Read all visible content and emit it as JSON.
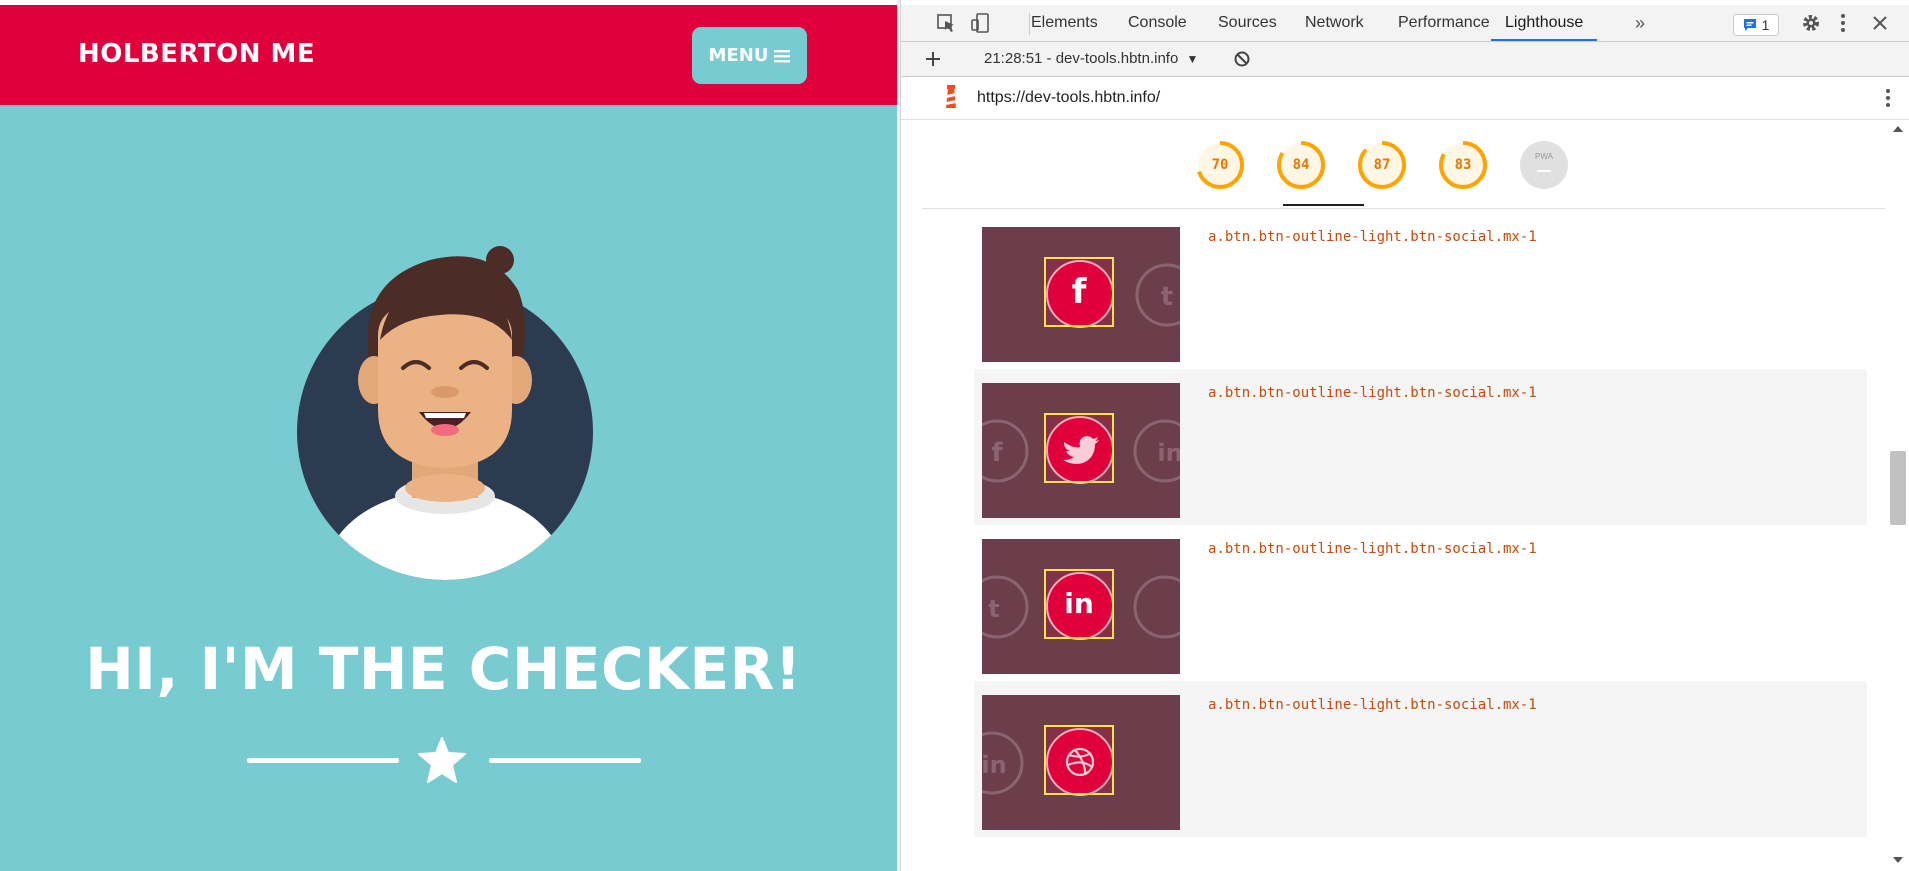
{
  "site": {
    "brand": "HOLBERTON ME",
    "menu_label": "MENU",
    "headline": "HI, I'M THE CHECKER!"
  },
  "devtools": {
    "tabs": [
      "Elements",
      "Console",
      "Sources",
      "Network",
      "Performance",
      "Lighthouse"
    ],
    "active_tab": "Lighthouse",
    "issues_count": "1",
    "report_label": "21:28:51 - dev-tools.hbtn.info",
    "url": "https://dev-tools.hbtn.info/",
    "scores": [
      {
        "value": "70",
        "fraction": 0.7
      },
      {
        "value": "84",
        "fraction": 0.84
      },
      {
        "value": "87",
        "fraction": 0.87
      },
      {
        "value": "83",
        "fraction": 0.83
      }
    ],
    "pwa_label": "PWA",
    "items": [
      {
        "selector": "a.btn.btn-outline-light.btn-social.mx-1",
        "icon": "facebook-icon",
        "glyph": "f"
      },
      {
        "selector": "a.btn.btn-outline-light.btn-social.mx-1",
        "icon": "twitter-icon",
        "glyph": ""
      },
      {
        "selector": "a.btn.btn-outline-light.btn-social.mx-1",
        "icon": "linkedin-icon",
        "glyph": "in"
      },
      {
        "selector": "a.btn.btn-outline-light.btn-social.mx-1",
        "icon": "dribbble-icon",
        "glyph": ""
      }
    ]
  },
  "colors": {
    "navbar": "#e0003b",
    "page_bg": "#78ccd1",
    "thumb_bg": "#6c3e4c",
    "gauge": "#ffa400"
  }
}
